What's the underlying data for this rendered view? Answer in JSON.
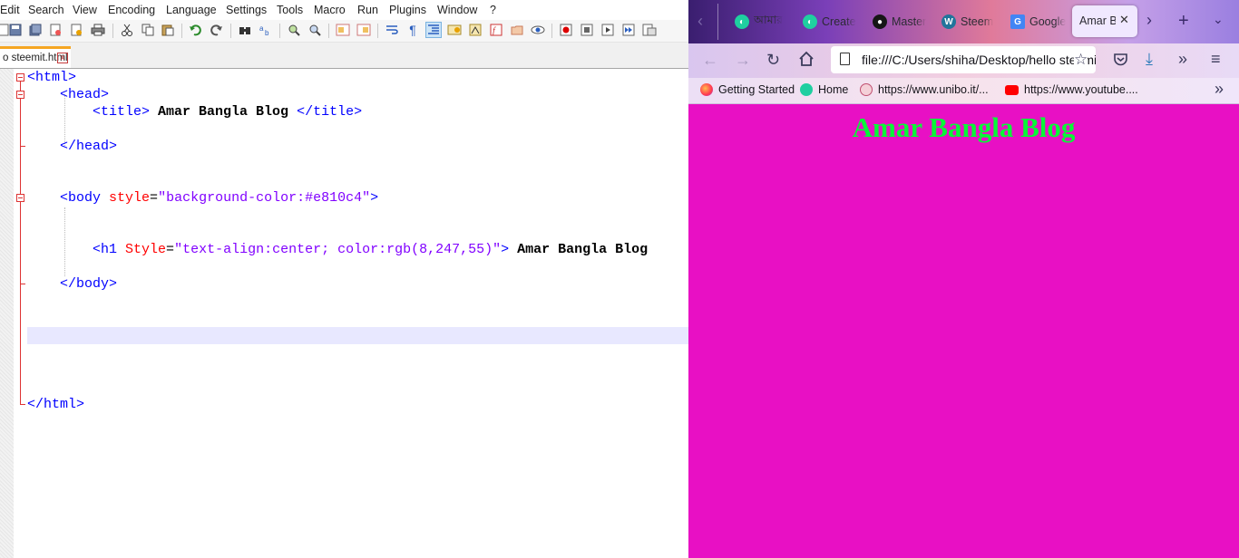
{
  "editor": {
    "menu": [
      "Edit",
      "Search",
      "View",
      "Encoding",
      "Language",
      "Settings",
      "Tools",
      "Macro",
      "Run",
      "Plugins",
      "Window",
      "?"
    ],
    "tab_label": "o steemit.html",
    "tab_close": "x",
    "code": [
      [
        [
          "t",
          "<html>"
        ]
      ],
      [
        [
          "",
          "    "
        ],
        [
          "t",
          "<head>"
        ]
      ],
      [
        [
          "",
          "        "
        ],
        [
          "t",
          "<title>"
        ],
        [
          "x",
          " Amar Bangla Blog "
        ],
        [
          "t",
          "</title>"
        ]
      ],
      [],
      [
        [
          "",
          "    "
        ],
        [
          "t",
          "</head>"
        ]
      ],
      [],
      [],
      [
        [
          "",
          "    "
        ],
        [
          "t",
          "<body "
        ],
        [
          "a",
          "style"
        ],
        [
          "",
          "="
        ],
        [
          "v",
          "\"background-color:#e810c4\""
        ],
        [
          "t",
          ">"
        ]
      ],
      [],
      [],
      [
        [
          "",
          "        "
        ],
        [
          "t",
          "<h1 "
        ],
        [
          "a",
          "Style"
        ],
        [
          "",
          "="
        ],
        [
          "v",
          "\"text-align:center; color:rgb(8,247,55)\""
        ],
        [
          "t",
          ">"
        ],
        [
          "x",
          " Amar Bangla Blog"
        ]
      ],
      [],
      [
        [
          "",
          "    "
        ],
        [
          "t",
          "</body>"
        ]
      ],
      [],
      [],
      [],
      [],
      [],
      [],
      [
        [
          "t",
          "</html>"
        ]
      ]
    ]
  },
  "browser": {
    "tabs": [
      {
        "label": "আমার",
        "favicon": "steemit-icon"
      },
      {
        "label": "Create",
        "favicon": "steemit-icon"
      },
      {
        "label": "Master",
        "favicon": "github-icon"
      },
      {
        "label": "Steem",
        "favicon": "wordpress-icon"
      },
      {
        "label": "Google",
        "favicon": "google-translate-icon"
      }
    ],
    "active_tab": {
      "label": "Amar Bangla Blog",
      "close": "✕"
    },
    "url": "file:///C:/Users/shiha/Desktop/hello steemit.html",
    "bookmarks": [
      {
        "label": "Getting Started",
        "favicon": "firefox-icon"
      },
      {
        "label": "Home",
        "favicon": "steemit-icon"
      },
      {
        "label": "https://www.unibo.it/...",
        "favicon": "unibo-icon"
      },
      {
        "label": "https://www.youtube....",
        "favicon": "youtube-icon"
      }
    ],
    "page": {
      "heading": "Amar Bangla Blog",
      "background": "#e810c4",
      "heading_color": "#08f737"
    }
  }
}
